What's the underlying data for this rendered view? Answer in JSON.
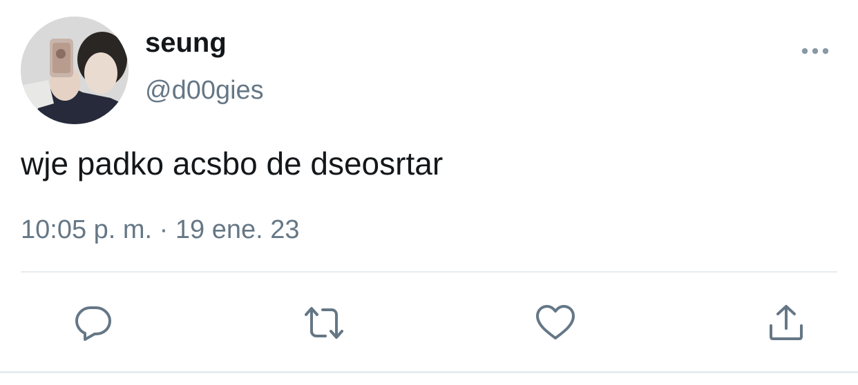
{
  "tweet": {
    "display_name": "seung",
    "handle": "@d00gies",
    "text": "wje padko acsbo de dseosrtar",
    "timestamp": "10:05 p. m. · 19 ene. 23"
  },
  "icons": {
    "more": "more-horizontal-icon",
    "reply": "reply-bubble-icon",
    "retweet": "retweet-arrows-icon",
    "like": "heart-icon",
    "share": "share-upload-icon"
  },
  "colors": {
    "text_primary": "#14171a",
    "text_secondary": "#657786",
    "icon": "#657786",
    "divider": "#e6ecf0"
  }
}
